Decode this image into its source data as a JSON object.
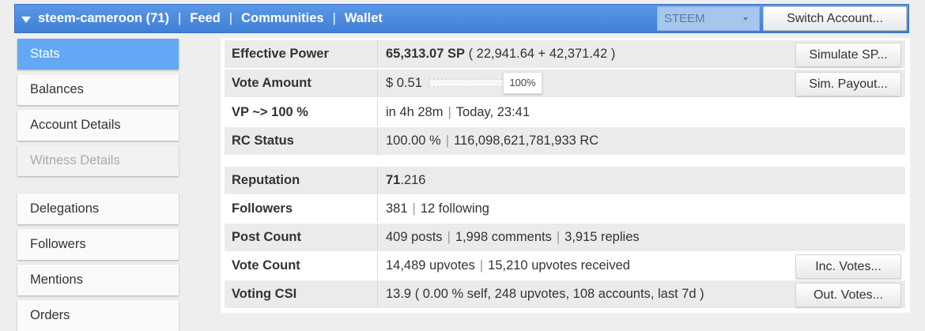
{
  "header": {
    "account": "steem-cameroon (71)",
    "nav": [
      "Feed",
      "Communities",
      "Wallet"
    ],
    "chain_select": "STEEM",
    "switch_account_label": "Switch Account..."
  },
  "sidebar": {
    "items": [
      {
        "label": "Stats",
        "state": "active"
      },
      {
        "label": "Balances",
        "state": "normal"
      },
      {
        "label": "Account Details",
        "state": "normal"
      },
      {
        "label": "Witness Details",
        "state": "disabled"
      },
      {
        "label": "Delegations",
        "state": "normal"
      },
      {
        "label": "Followers",
        "state": "normal"
      },
      {
        "label": "Mentions",
        "state": "normal"
      },
      {
        "label": "Orders",
        "state": "normal"
      }
    ]
  },
  "stats": {
    "effective_power": {
      "label": "Effective Power",
      "value": "65,313.07 SP",
      "detail": "( 22,941.64 + 42,371.42 )",
      "button": "Simulate SP..."
    },
    "vote_amount": {
      "label": "Vote Amount",
      "value": "$ 0.51",
      "slider_percent": 100,
      "slider_label": "100%",
      "button": "Sim. Payout..."
    },
    "vp": {
      "label": "VP ~> 100 %",
      "value": "in 4h 28m",
      "detail": "Today, 23:41"
    },
    "rc": {
      "label": "RC Status",
      "value": "100.00 %",
      "detail": "116,098,621,781,933 RC"
    },
    "reputation": {
      "label": "Reputation",
      "int": "71",
      "frac": ".216"
    },
    "followers": {
      "label": "Followers",
      "value": "381",
      "detail": "12 following"
    },
    "post_count": {
      "label": "Post Count",
      "posts": "409 posts",
      "comments": "1,998 comments",
      "replies": "3,915 replies"
    },
    "vote_count": {
      "label": "Vote Count",
      "value": "14,489 upvotes",
      "detail": "15,210 upvotes received",
      "button": "Inc. Votes..."
    },
    "voting_csi": {
      "label": "Voting CSI",
      "value": "13.9 ( 0.00 % self, 248 upvotes, 108 accounts, last 7d )",
      "button": "Out. Votes..."
    }
  },
  "colors": {
    "topbar": "#4a8ae0",
    "active_tab": "#62a8f5",
    "row_shade": "#ebebeb"
  }
}
